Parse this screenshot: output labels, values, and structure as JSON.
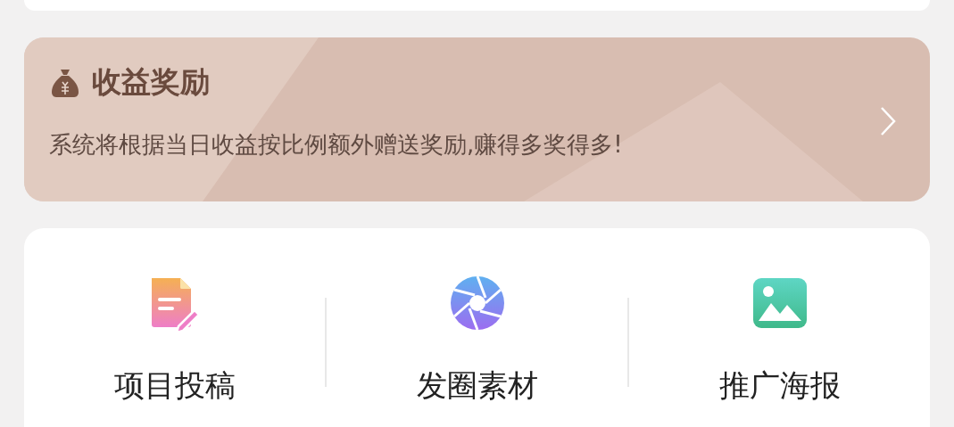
{
  "reward_card": {
    "title": "收益奖励",
    "description": "系统将根据当日收益按比例额外赠送奖励,赚得多奖得多!"
  },
  "shortcuts": [
    {
      "label": "项目投稿",
      "kind": "document"
    },
    {
      "label": "发圈素材",
      "kind": "aperture"
    },
    {
      "label": "推广海报",
      "kind": "image"
    }
  ]
}
